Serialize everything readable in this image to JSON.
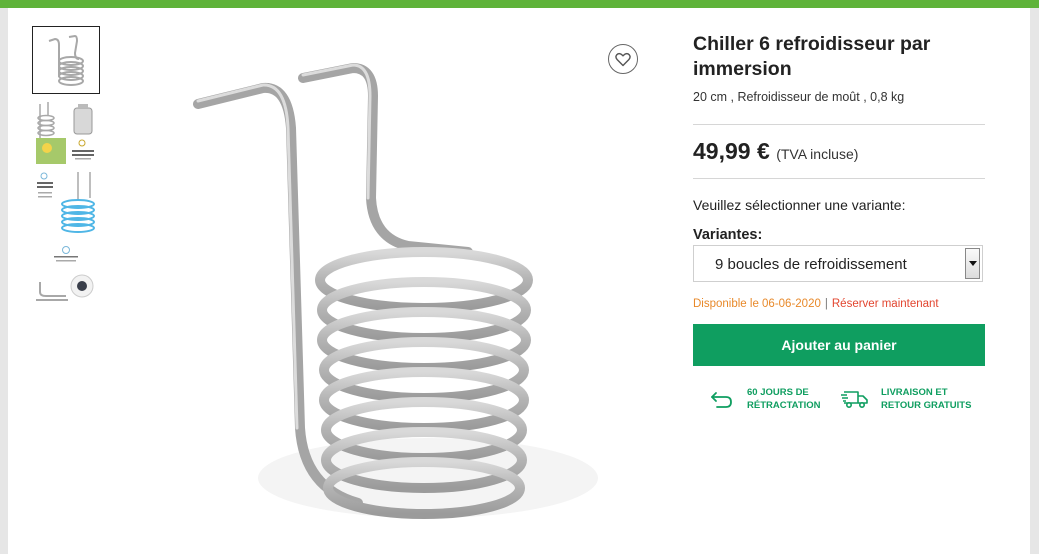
{
  "product": {
    "title": "Chiller 6 refroidisseur par immersion",
    "subtitle": "20 cm , Refroidisseur de moût , 0,8 kg",
    "price": "49,99 €",
    "vat_note": "(TVA incluse)"
  },
  "variant": {
    "prompt": "Veuillez sélectionner une variante:",
    "label": "Variantes:",
    "selected": "9 boucles de refroidissement"
  },
  "availability": {
    "date_text": "Disponible le 06-06-2020",
    "separator": "|",
    "reserve_link": "Réserver maintenant"
  },
  "cart_button": "Ajouter au panier",
  "perks": [
    {
      "line1": "60 JOURS DE",
      "line2": "RÉTRACTATION",
      "icon": "return-arrow-icon"
    },
    {
      "line1": "LIVRAISON ET",
      "line2": "RETOUR GRATUITS",
      "icon": "delivery-truck-icon"
    }
  ],
  "thumbnails": [
    {
      "icon": "coil-thumbnail"
    },
    {
      "icon": "coil-with-kettle-thumbnail"
    },
    {
      "icon": "coil-in-water-thumbnail"
    },
    {
      "icon": "coil-detail-thumbnail"
    }
  ],
  "colors": {
    "top_bar": "#5fb33a",
    "cart_button": "#0f9e60",
    "availability": "#e8892a",
    "reserve_link": "#e2452f",
    "perk_text": "#0f9e60"
  }
}
